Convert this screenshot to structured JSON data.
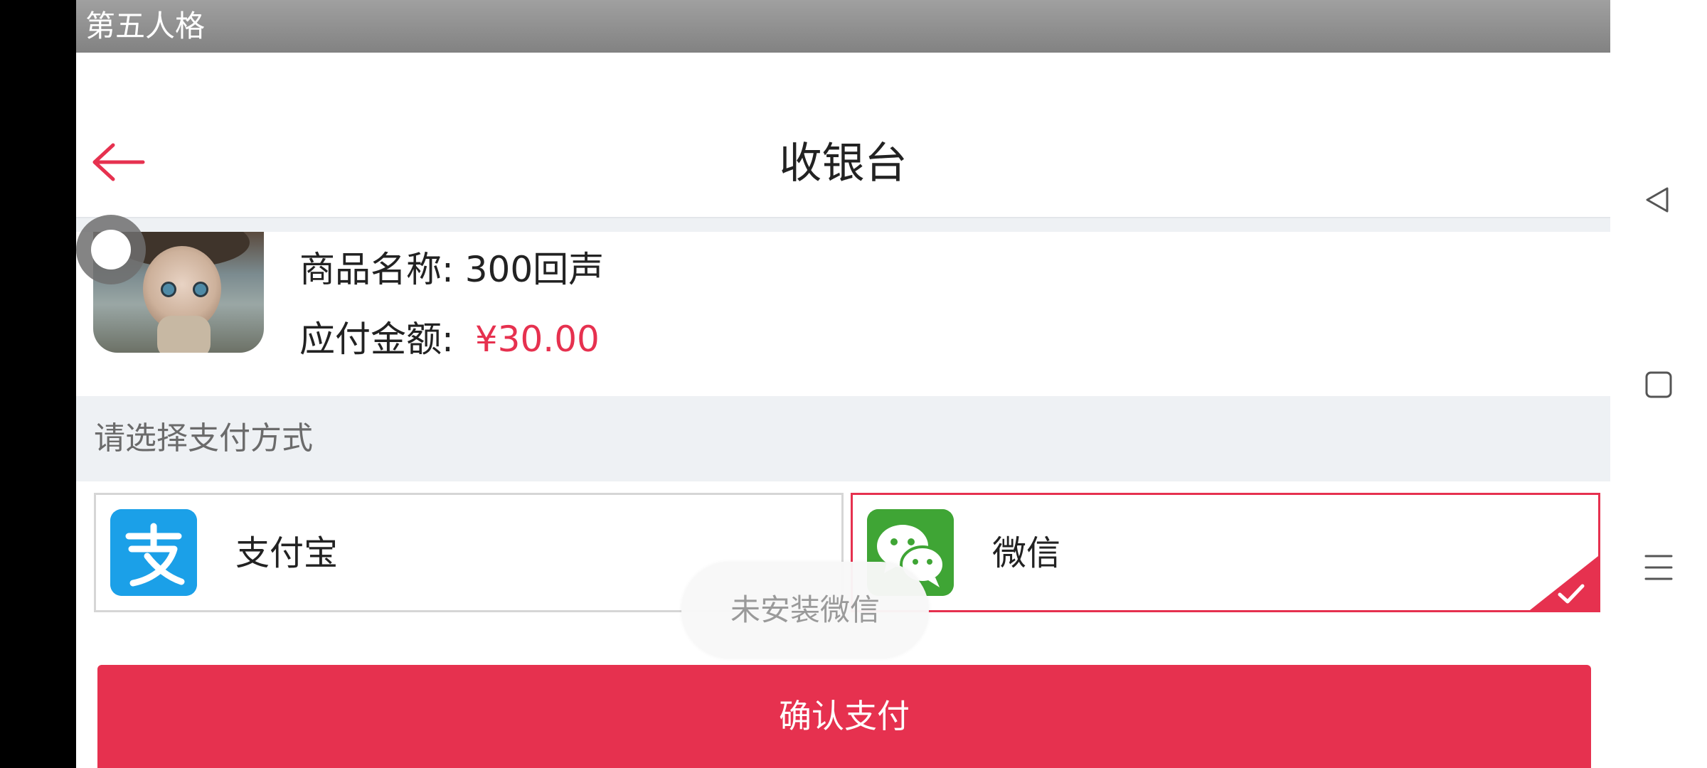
{
  "status_bar": {
    "app_name": "第五人格"
  },
  "header": {
    "title": "收银台"
  },
  "product": {
    "name_line": "商品名称: 300回声",
    "amount_label": "应付金额:",
    "amount_value": "¥30.00"
  },
  "payment": {
    "section_label": "请选择支付方式",
    "options": [
      {
        "label": "支付宝",
        "selected": false
      },
      {
        "label": "微信",
        "selected": true
      }
    ]
  },
  "toast": {
    "message": "未安装微信"
  },
  "confirm": {
    "label": "确认支付"
  },
  "colors": {
    "accent": "#e6314f",
    "alipay": "#1ba0e8",
    "wechat": "#3fa535",
    "band": "#eef1f4"
  },
  "icons": {
    "back": "arrow-left-icon",
    "alipay": "alipay-icon",
    "wechat": "wechat-icon",
    "check": "check-icon",
    "nav_back": "triangle-back-icon",
    "nav_home": "square-home-icon",
    "nav_menu": "menu-lines-icon"
  }
}
